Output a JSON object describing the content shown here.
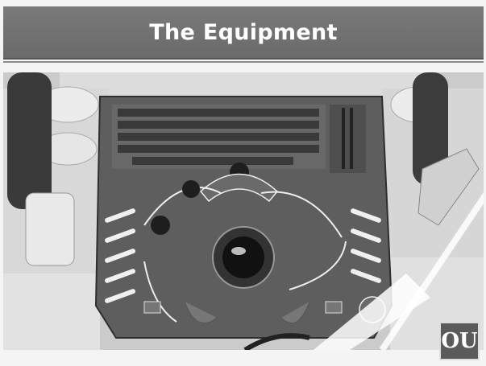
{
  "slide": {
    "title": "The Equipment"
  },
  "photo": {
    "subject": "ultrasound-console-control-panel",
    "icon": "photo-icon"
  },
  "logo": {
    "text": "OU",
    "icon": "university-logo-icon"
  },
  "colors": {
    "title_bar": "#6e6e6e",
    "title_text": "#ffffff",
    "background": "#f4f4f4",
    "logo_box": "#5a5a5a"
  }
}
